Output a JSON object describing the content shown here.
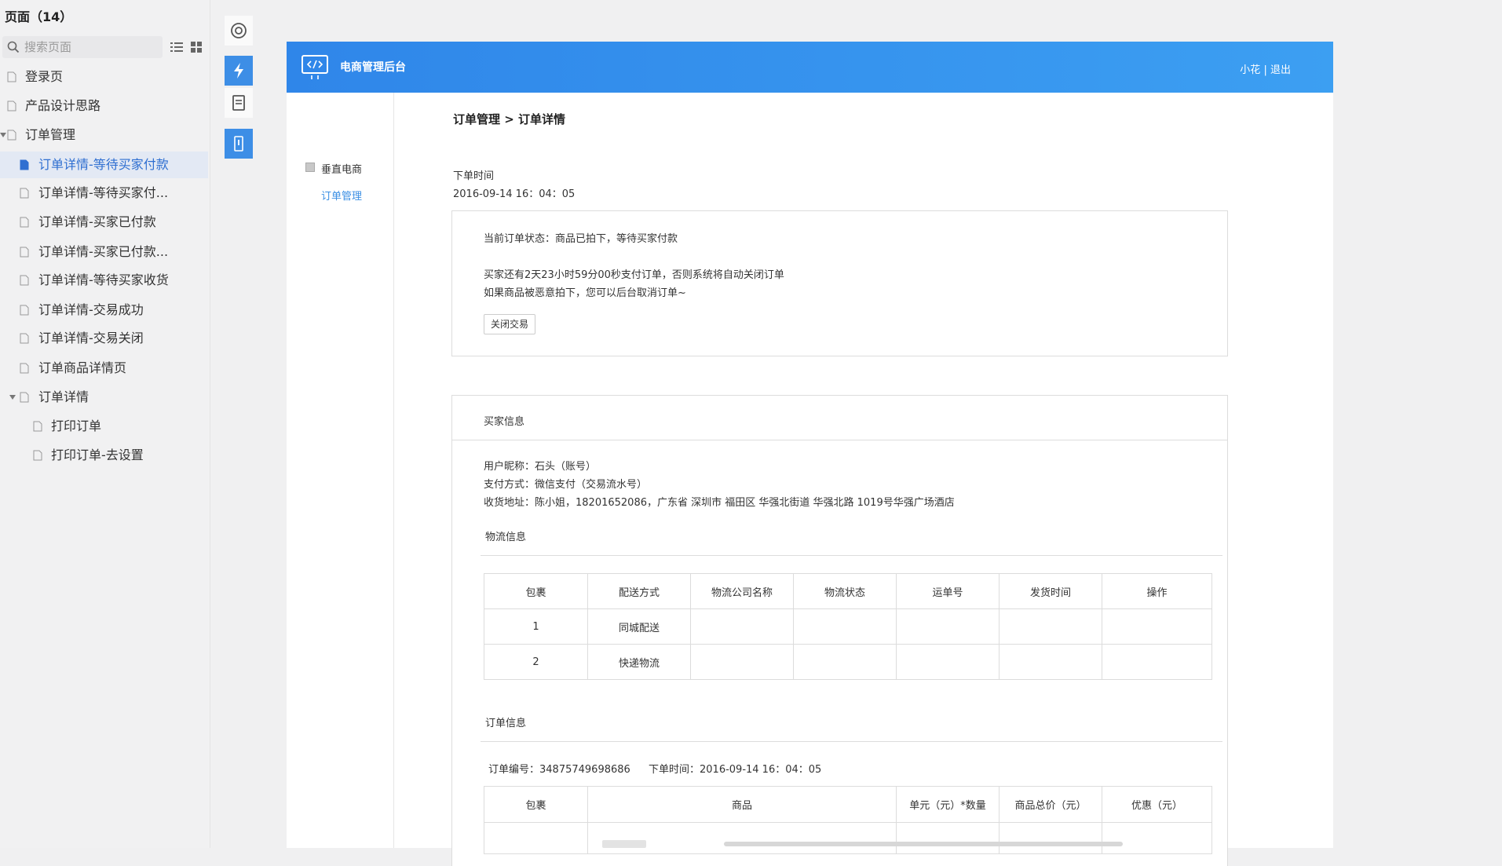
{
  "left_panel": {
    "title": "页面（14）",
    "search_placeholder": "搜索页面",
    "items": [
      {
        "label": "登录页"
      },
      {
        "label": "产品设计思路"
      },
      {
        "label": "订单管理"
      },
      {
        "label": "订单详情-等待买家付款",
        "active": true
      },
      {
        "label": "订单详情-等待买家付..."
      },
      {
        "label": "订单详情-买家已付款"
      },
      {
        "label": "订单详情-买家已付款..."
      },
      {
        "label": "订单详情-等待买家收货"
      },
      {
        "label": "订单详情-交易成功"
      },
      {
        "label": "订单详情-交易关闭"
      },
      {
        "label": "订单商品详情页"
      },
      {
        "label": "订单详情"
      },
      {
        "label": "打印订单"
      },
      {
        "label": "打印订单-去设置"
      }
    ]
  },
  "tool_strip": {
    "icons": [
      "target-icon",
      "lightning-icon",
      "document-icon",
      "mobile-icon"
    ]
  },
  "app": {
    "title": "电商管理后台",
    "user": "小花",
    "separator": "|",
    "logout": "退出",
    "nav": {
      "group": "垂直电商",
      "sub": "订单管理"
    },
    "breadcrumb": "订单管理 > 订单详情",
    "order_time_label": "下单时间",
    "order_time_value": "2016-09-14 16：04：05",
    "status_card": {
      "status": "当前订单状态：商品已拍下，等待买家付款",
      "line1": "买家还有2天23小时59分00秒支付订单，否则系统将自动关闭订单",
      "line2": "如果商品被恶意拍下，您可以后台取消订单~",
      "close_button": "关闭交易"
    },
    "buyer": {
      "title": "买家信息",
      "nickname": "用户昵称：石头（账号）",
      "payment": "支付方式：微信支付（交易流水号）",
      "address": "收货地址：陈小姐，18201652086，广东省 深圳市 福田区 华强北街道 华强北路 1019号华强广场酒店"
    },
    "logistics": {
      "title": "物流信息",
      "columns": [
        "包裹",
        "配送方式",
        "物流公司名称",
        "物流状态",
        "运单号",
        "发货时间",
        "操作"
      ],
      "rows": [
        [
          "1",
          "同城配送",
          "",
          "",
          "",
          "",
          ""
        ],
        [
          "2",
          "快递物流",
          "",
          "",
          "",
          "",
          ""
        ]
      ]
    },
    "order_info": {
      "title": "订单信息",
      "order_no": "订单编号：34875749698686",
      "order_time": "下单时间：2016-09-14 16：04：05",
      "columns": [
        "包裹",
        "商品",
        "单元（元）*数量",
        "商品总价（元）",
        "优惠（元）"
      ]
    }
  }
}
